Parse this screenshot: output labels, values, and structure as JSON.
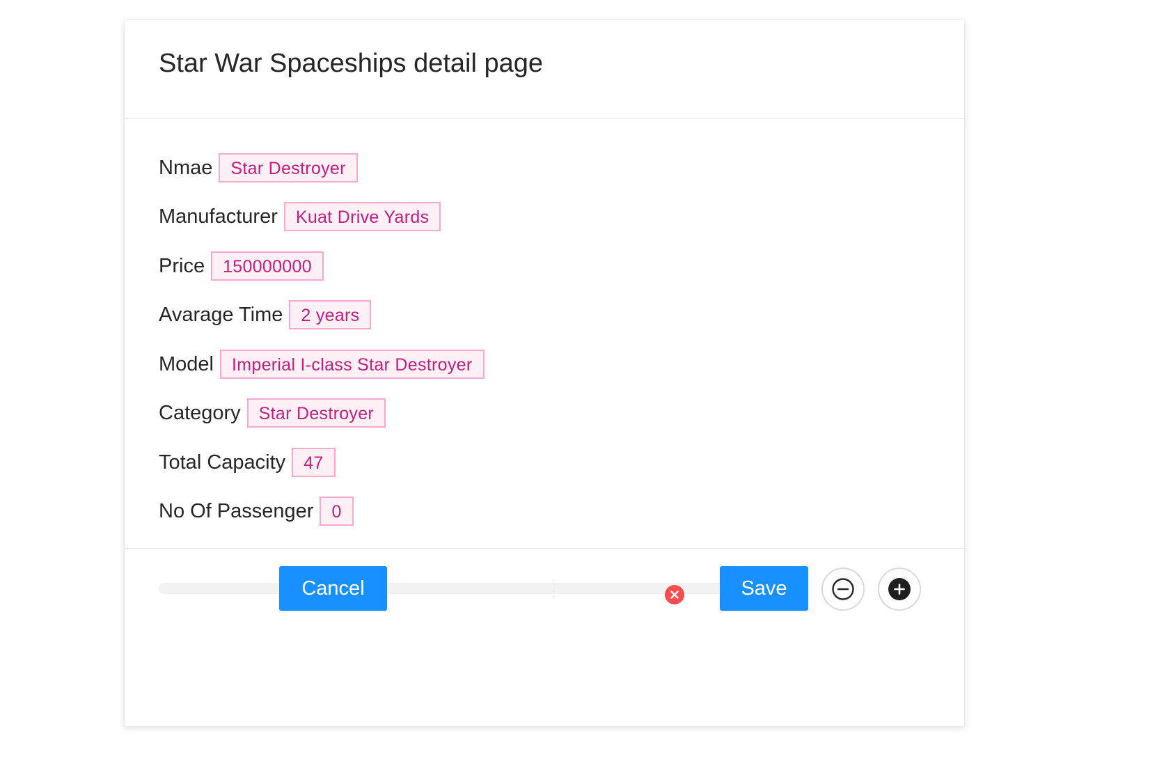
{
  "modal": {
    "title": "Star War Spaceships detail page"
  },
  "fields": [
    {
      "label": "Nmae",
      "value": "Star Destroyer"
    },
    {
      "label": "Manufacturer",
      "value": "Kuat Drive Yards"
    },
    {
      "label": "Price",
      "value": "150000000"
    },
    {
      "label": "Avarage Time",
      "value": "2 years"
    },
    {
      "label": "Model",
      "value": "Imperial I-class Star Destroyer"
    },
    {
      "label": "Category",
      "value": "Star Destroyer"
    },
    {
      "label": "Total Capacity",
      "value": "47"
    },
    {
      "label": "No Of Passenger",
      "value": "0"
    }
  ],
  "progress": {
    "percent": 0,
    "status": "exception",
    "status_icon": "close-circle-icon",
    "status_color": "#ff4d4f"
  },
  "controls": {
    "decrease_icon": "minus-circle-icon",
    "increase_icon": "plus-circle-icon"
  },
  "footer": {
    "cancel_label": "Cancel",
    "save_label": "Save"
  },
  "colors": {
    "primary": "#1890ff",
    "tag_text": "#c41d7f",
    "tag_border": "#f9a9cf",
    "tag_background": "#fff0f6",
    "error": "#ff4d4f"
  }
}
